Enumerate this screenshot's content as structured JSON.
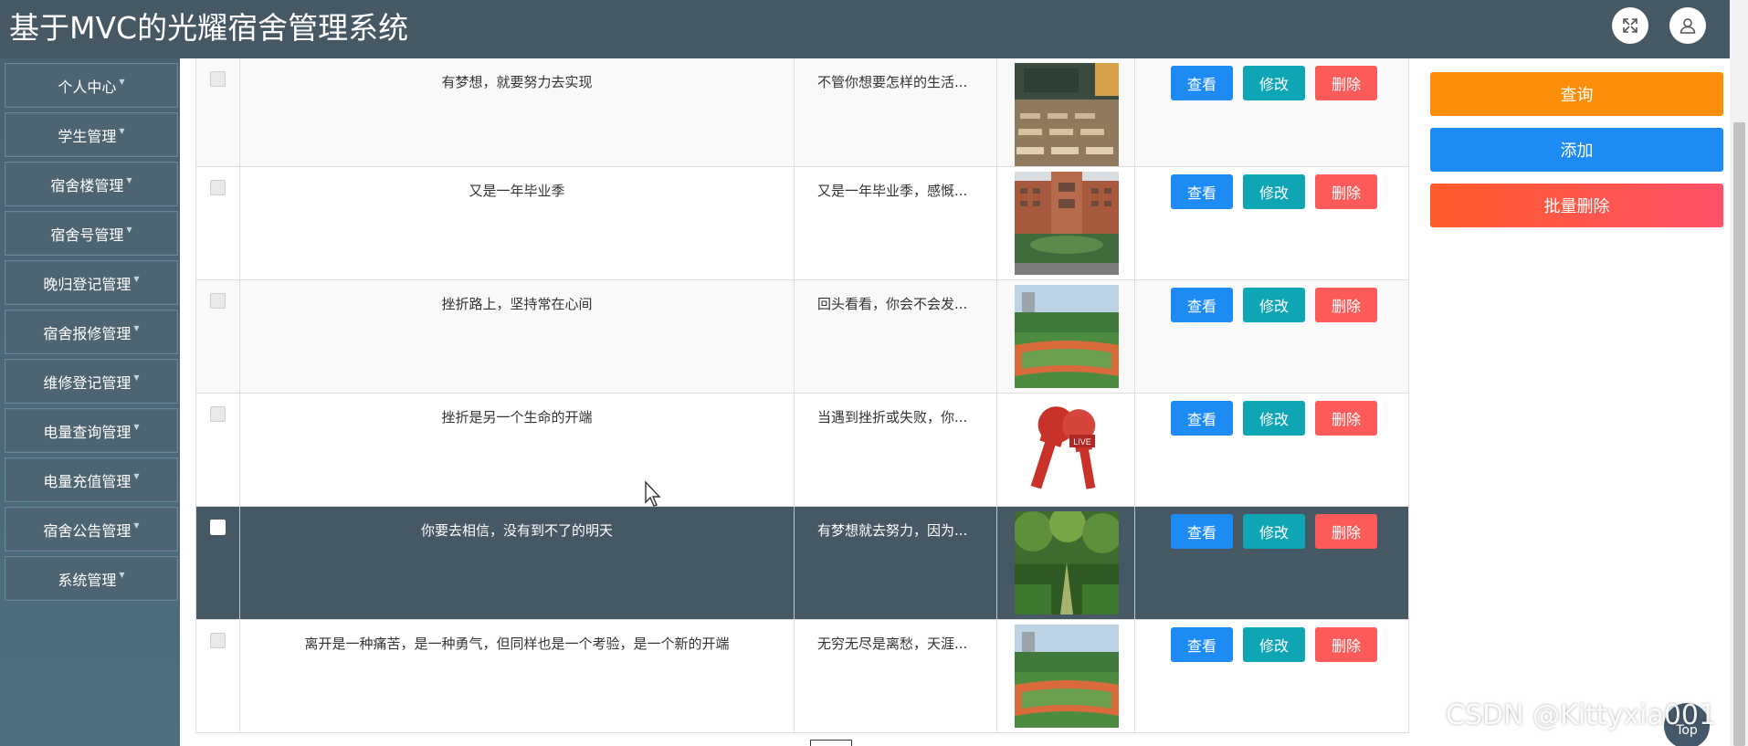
{
  "header": {
    "title": "基于MVC的光耀宿舍管理系统",
    "fullscreen_icon": "expand-icon",
    "user_icon": "user-icon"
  },
  "sidebar": {
    "items": [
      {
        "label": "个人中心"
      },
      {
        "label": "学生管理"
      },
      {
        "label": "宿舍楼管理"
      },
      {
        "label": "宿舍号管理"
      },
      {
        "label": "晚归登记管理"
      },
      {
        "label": "宿舍报修管理"
      },
      {
        "label": "维修登记管理"
      },
      {
        "label": "电量查询管理"
      },
      {
        "label": "电量充值管理"
      },
      {
        "label": "宿舍公告管理"
      },
      {
        "label": "系统管理"
      }
    ]
  },
  "table": {
    "actions": {
      "view": "查看",
      "edit": "修改",
      "delete": "删除"
    },
    "rows": [
      {
        "title": "有梦想，就要努力去实现",
        "content": "不管你想要怎样的生活...",
        "image": "classroom",
        "selected": false
      },
      {
        "title": "又是一年毕业季",
        "content": "又是一年毕业季，感慨...",
        "image": "campus-building",
        "selected": false
      },
      {
        "title": "挫折路上，坚持常在心间",
        "content": "回头看看，你会不会发...",
        "image": "sports-field",
        "selected": false
      },
      {
        "title": "挫折是另一个生命的开端",
        "content": "当遇到挫折或失败，你...",
        "image": "news-microphone",
        "selected": false
      },
      {
        "title": "你要去相信，没有到不了的明天",
        "content": "有梦想就去努力，因为...",
        "image": "tree-path",
        "selected": true
      },
      {
        "title": "离开是一种痛苦，是一种勇气，但同样也是一个考验，是一个新的开端",
        "content": "无穷无尽是离愁，天涯...",
        "image": "sports-field",
        "selected": false
      }
    ]
  },
  "right_panel": {
    "query": "查询",
    "add": "添加",
    "bulk_delete": "批量删除"
  },
  "watermark": "CSDN @Kittyxia001",
  "top_button": "Top",
  "colors": {
    "header": "#475865",
    "view": "#1e8bf5",
    "edit": "#0ea5b5",
    "delete": "#fd5a5a",
    "query": "#fd8e0b"
  }
}
